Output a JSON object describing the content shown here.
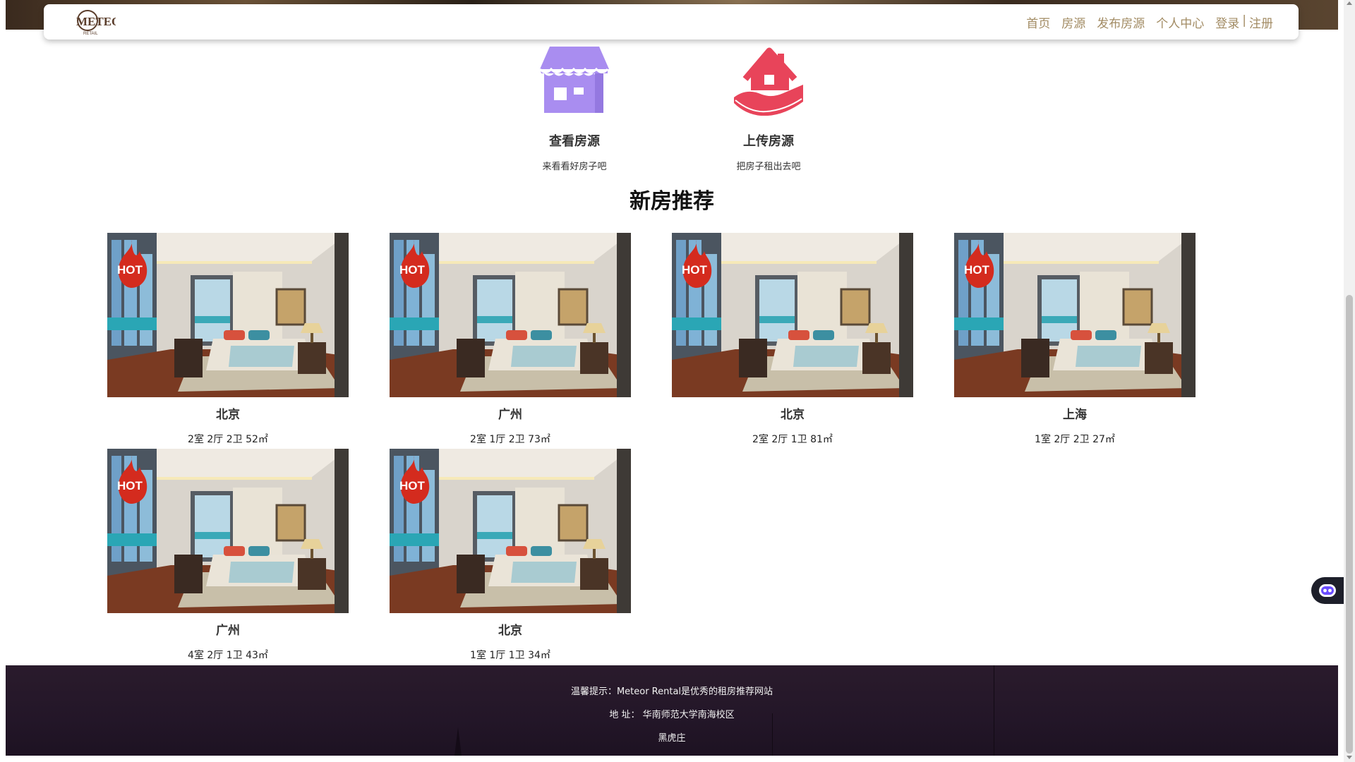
{
  "nav": {
    "logo_text": "METEOR",
    "logo_sub": "RETAIL",
    "links": [
      "首页",
      "房源",
      "发布房源",
      "个人中心"
    ],
    "login": "登录",
    "separator": "|",
    "register": "注册"
  },
  "features": {
    "view": {
      "title": "查看房源",
      "subtitle": "来看看好房子吧",
      "icon": "storefront-icon",
      "color": "#a98df0"
    },
    "upload": {
      "title": "上传房源",
      "subtitle": "把房子租出去吧",
      "icon": "house-in-hand-icon",
      "color": "#e8445a"
    }
  },
  "section": {
    "title": "新房推荐"
  },
  "hot_badge": "HOT",
  "houses": [
    {
      "city": "北京",
      "layout": "2室 2厅 2卫 52㎡"
    },
    {
      "city": "广州",
      "layout": "2室 1厅 2卫 73㎡"
    },
    {
      "city": "北京",
      "layout": "2室 2厅 1卫 81㎡"
    },
    {
      "city": "上海",
      "layout": "1室 2厅 2卫 27㎡"
    },
    {
      "city": "广州",
      "layout": "4室 2厅 1卫 43㎡"
    },
    {
      "city": "北京",
      "layout": "1室 1厅 1卫 34㎡"
    }
  ],
  "footer": {
    "tip": "温馨提示：Meteor Rental是优秀的租房推荐网站",
    "address": "地 址： 华南师范大学南海校区",
    "owner": "黑虎庄"
  },
  "colors": {
    "nav_text": "#a28b63",
    "footer_bg": "#241729",
    "hot_red": "#d42b1e"
  }
}
